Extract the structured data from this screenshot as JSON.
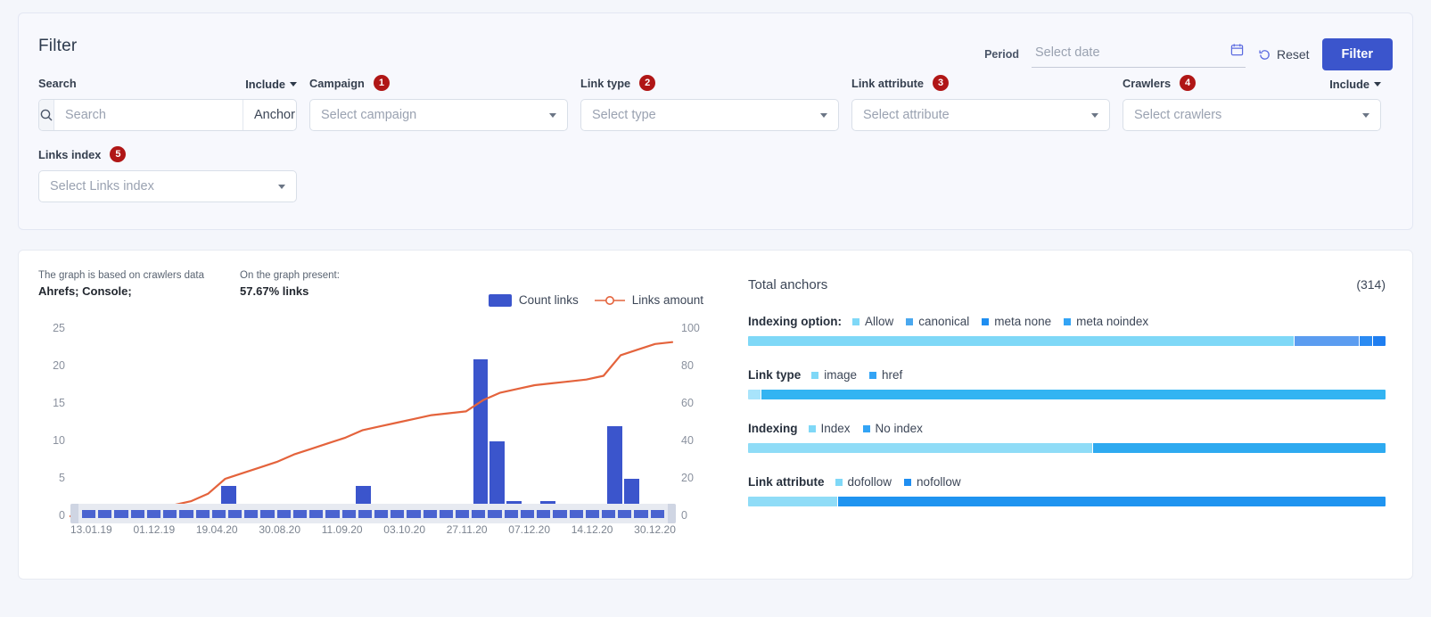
{
  "filter": {
    "title": "Filter",
    "period_label": "Period",
    "date_placeholder": "Select date",
    "reset_label": "Reset",
    "filter_button": "Filter",
    "search": {
      "label": "Search",
      "include_label": "Include",
      "placeholder": "Search",
      "value": "",
      "scope": "Anchor"
    },
    "fields": [
      {
        "label": "Campaign",
        "badge": "1",
        "placeholder": "Select campaign",
        "include": ""
      },
      {
        "label": "Link type",
        "badge": "2",
        "placeholder": "Select type",
        "include": ""
      },
      {
        "label": "Link attribute",
        "badge": "3",
        "placeholder": "Select attribute",
        "include": ""
      },
      {
        "label": "Crawlers",
        "badge": "4",
        "placeholder": "Select crawlers",
        "include": "Include"
      },
      {
        "label": "Links index",
        "badge": "5",
        "placeholder": "Select Links index",
        "include": ""
      }
    ]
  },
  "chart_panel": {
    "note_caption": "The graph is based on crawlers data",
    "note_value": "Ahrefs; Console;",
    "present_caption": "On the graph present:",
    "present_value": "57.67% links"
  },
  "chart_data": {
    "type": "bar",
    "title": "",
    "xlabel": "",
    "ylabel": "",
    "ylim": [
      0,
      25
    ],
    "y2lim": [
      0,
      100
    ],
    "grid": false,
    "legend_position": "top-right",
    "yticks": [
      0,
      5,
      10,
      15,
      20,
      25
    ],
    "y2ticks": [
      0,
      20,
      40,
      60,
      80,
      100
    ],
    "xtick_labels": [
      "13.01.19",
      "01.12.19",
      "19.04.20",
      "30.08.20",
      "11.09.20",
      "03.10.20",
      "27.11.20",
      "07.12.20",
      "14.12.20",
      "30.12.20"
    ],
    "series": [
      {
        "name": "Count links",
        "type": "bar",
        "color": "#3b55cc",
        "axis": "left",
        "values": [
          0,
          0,
          0,
          0,
          0,
          0,
          0,
          0,
          0,
          4,
          0,
          0,
          0,
          0,
          0,
          0,
          0,
          4,
          0,
          0,
          0,
          0,
          0,
          0,
          21,
          10,
          2,
          1,
          2,
          1,
          0,
          1,
          12,
          5,
          0,
          0
        ]
      },
      {
        "name": "Links amount",
        "type": "line",
        "color": "#e4633c",
        "axis": "right",
        "values": [
          0,
          1,
          2,
          3,
          4,
          5,
          6,
          8,
          12,
          20,
          23,
          26,
          29,
          33,
          36,
          39,
          42,
          46,
          48,
          50,
          52,
          54,
          55,
          56,
          62,
          66,
          68,
          70,
          71,
          72,
          73,
          75,
          86,
          89,
          92,
          93
        ]
      }
    ]
  },
  "anchors": {
    "title": "Total anchors",
    "count": "(314)",
    "metrics": [
      {
        "name": "Indexing option:",
        "legend": [
          {
            "label": "Allow",
            "color": "#7fd8f7"
          },
          {
            "label": "canonical",
            "color": "#4aa8ef"
          },
          {
            "label": "meta none",
            "color": "#1f8ef1"
          },
          {
            "label": "meta noindex",
            "color": "#33a4f5"
          }
        ],
        "segments": [
          {
            "value": 86,
            "color": "#7fd8f7"
          },
          {
            "value": 10,
            "color": "#5b9cf0"
          },
          {
            "value": 2,
            "color": "#2b8bf2"
          },
          {
            "value": 2,
            "color": "#1f7ef0"
          }
        ]
      },
      {
        "name": "Link type",
        "legend": [
          {
            "label": "image",
            "color": "#7fd8f7"
          },
          {
            "label": "href",
            "color": "#33a4f5"
          }
        ],
        "segments": [
          {
            "value": 2,
            "color": "#a8e4fb"
          },
          {
            "value": 98,
            "color": "#33b4f2"
          }
        ]
      },
      {
        "name": "Indexing",
        "legend": [
          {
            "label": "Index",
            "color": "#7fd8f7"
          },
          {
            "label": "No index",
            "color": "#33a4f5"
          }
        ],
        "segments": [
          {
            "value": 54,
            "color": "#8fdcf7"
          },
          {
            "value": 46,
            "color": "#2eaaf0"
          }
        ]
      },
      {
        "name": "Link attribute",
        "legend": [
          {
            "label": "dofollow",
            "color": "#7fd8f7"
          },
          {
            "label": "nofollow",
            "color": "#1f8ef1"
          }
        ],
        "segments": [
          {
            "value": 14,
            "color": "#8fdcf7"
          },
          {
            "value": 86,
            "color": "#1f94f0"
          }
        ]
      }
    ]
  },
  "colors": {
    "accent": "#3b55cc",
    "badge": "#b01616",
    "line": "#e4633c"
  }
}
